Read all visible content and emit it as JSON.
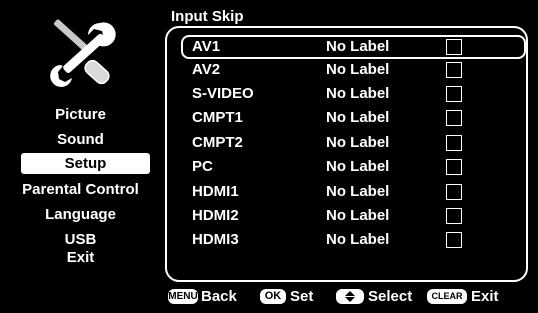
{
  "panel_title": "Input Skip",
  "menu": {
    "items": [
      {
        "label": "Picture",
        "active": false
      },
      {
        "label": "Sound",
        "active": false
      },
      {
        "label": "Setup",
        "active": true
      },
      {
        "label": "Parental Control",
        "active": false
      },
      {
        "label": "Language",
        "active": false
      },
      {
        "label": "USB",
        "active": false
      },
      {
        "label": "Exit",
        "active": false
      }
    ]
  },
  "inputs": [
    {
      "name": "AV1",
      "label": "No Label",
      "skip": false,
      "selected": true
    },
    {
      "name": "AV2",
      "label": "No Label",
      "skip": false,
      "selected": false
    },
    {
      "name": "S-VIDEO",
      "label": "No Label",
      "skip": false,
      "selected": false
    },
    {
      "name": "CMPT1",
      "label": "No Label",
      "skip": false,
      "selected": false
    },
    {
      "name": "CMPT2",
      "label": "No Label",
      "skip": false,
      "selected": false
    },
    {
      "name": "PC",
      "label": "No Label",
      "skip": false,
      "selected": false
    },
    {
      "name": "HDMI1",
      "label": "No Label",
      "skip": false,
      "selected": false
    },
    {
      "name": "HDMI2",
      "label": "No Label",
      "skip": false,
      "selected": false
    },
    {
      "name": "HDMI3",
      "label": "No Label",
      "skip": false,
      "selected": false
    }
  ],
  "footer": {
    "menu_key": "MENU",
    "back": "Back",
    "ok_key": "OK",
    "set": "Set",
    "select": "Select",
    "clear_key": "CLEAR",
    "exit": "Exit"
  },
  "icons": {
    "settings": "wrench-screwdriver-icon",
    "navigate": "up-down-arrow-icon"
  }
}
